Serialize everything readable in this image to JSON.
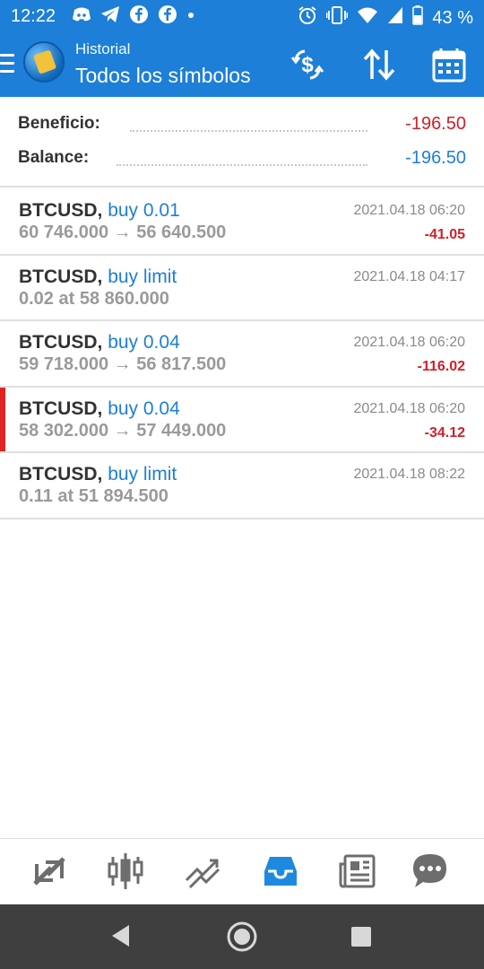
{
  "status_bar": {
    "time": "12:22",
    "battery": "43 %"
  },
  "app_bar": {
    "subtitle": "Historial",
    "title": "Todos los símbolos",
    "icons": [
      "menu-icon",
      "metatrader-logo-icon",
      "currency-exchange-icon",
      "sort-icon",
      "calendar-icon"
    ]
  },
  "summary": {
    "profit_label": "Beneficio:",
    "profit_value": "-196.50",
    "balance_label": "Balance:",
    "balance_value": "-196.50"
  },
  "orders": [
    {
      "symbol": "BTCUSD,",
      "type": "buy 0.01",
      "details": "60 746.000 → 56 640.500",
      "date": "2021.04.18 06:20",
      "profit": "-41.05",
      "highlighted": false
    },
    {
      "symbol": "BTCUSD,",
      "type": "buy limit",
      "details": "0.02 at 58 860.000",
      "date": "2021.04.18 04:17",
      "profit": "",
      "highlighted": false
    },
    {
      "symbol": "BTCUSD,",
      "type": "buy 0.04",
      "details": "59 718.000 → 56 817.500",
      "date": "2021.04.18 06:20",
      "profit": "-116.02",
      "highlighted": false
    },
    {
      "symbol": "BTCUSD,",
      "type": "buy 0.04",
      "details": "58 302.000 → 57 449.000",
      "date": "2021.04.18 06:20",
      "profit": "-34.12",
      "highlighted": true
    },
    {
      "symbol": "BTCUSD,",
      "type": "buy limit",
      "details": "0.11 at 51 894.500",
      "date": "2021.04.18 08:22",
      "profit": "",
      "highlighted": false
    }
  ],
  "bottom_nav": [
    "quotes-icon",
    "chart-icon",
    "trade-icon",
    "history-icon",
    "news-icon",
    "chat-icon"
  ],
  "colors": {
    "accent_blue": "#1d7fd7",
    "loss_red": "#d0202a",
    "active_nav": "#1d8ae0"
  }
}
